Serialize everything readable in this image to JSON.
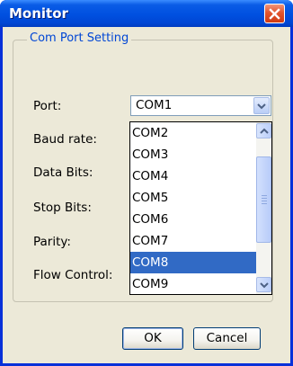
{
  "window": {
    "title": "Monitor"
  },
  "group": {
    "legend": "Com Port Setting"
  },
  "labels": {
    "port": "Port:",
    "baud_rate": "Baud rate:",
    "data_bits": "Data Bits:",
    "stop_bits": "Stop Bits:",
    "parity": "Parity:",
    "flow_control": "Flow Control:"
  },
  "port_combo": {
    "value": "COM1"
  },
  "dropdown": {
    "items": [
      "COM2",
      "COM3",
      "COM4",
      "COM5",
      "COM6",
      "COM7",
      "COM8",
      "COM9"
    ],
    "selected": "COM8"
  },
  "buttons": {
    "ok": "OK",
    "cancel": "Cancel"
  },
  "icons": {
    "close": "close-icon",
    "combo_arrow": "chevron-down-icon",
    "scroll_up": "chevron-up-icon",
    "scroll_down": "chevron-down-icon"
  },
  "colors": {
    "titlebar": "#0050e0",
    "dialog_bg": "#ece9d8",
    "legend_text": "#0046d5",
    "selection": "#316ac5",
    "close_button": "#e2552e"
  }
}
